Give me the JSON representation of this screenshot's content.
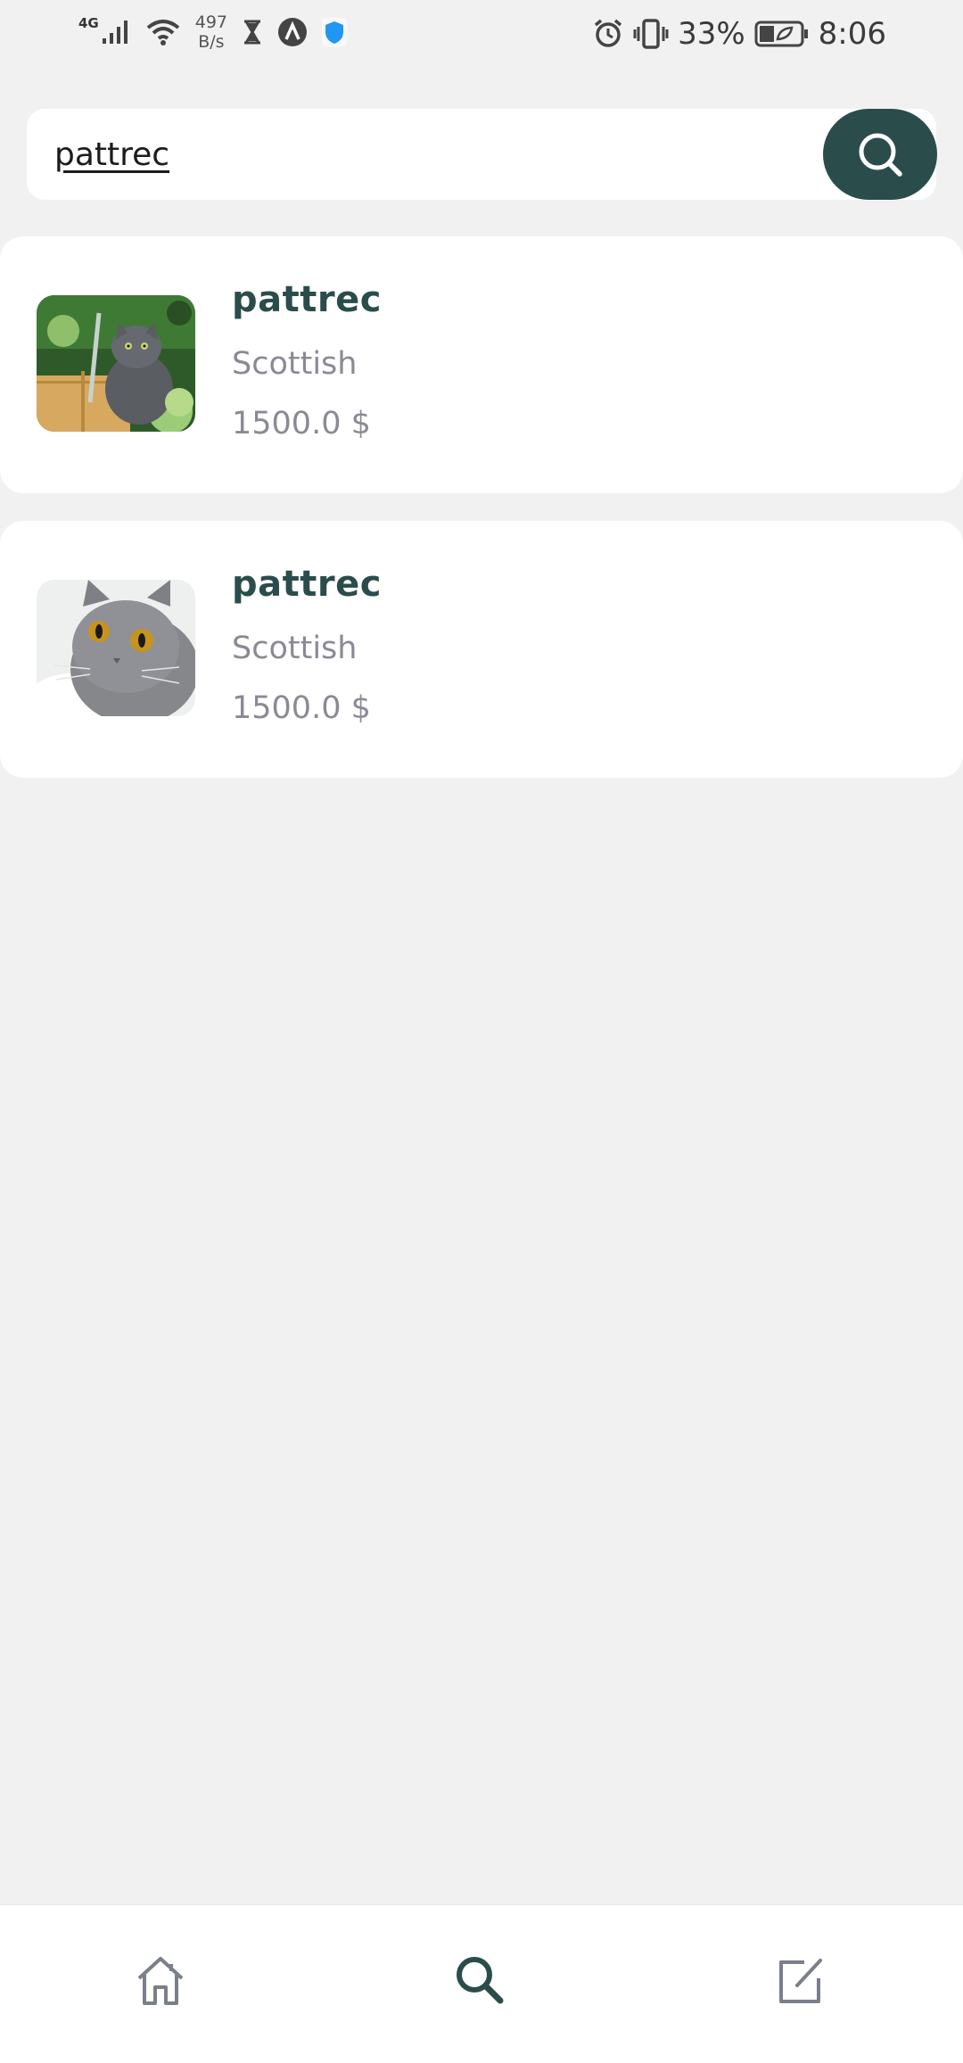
{
  "status_bar": {
    "network_type": "4G",
    "net_speed_value": "497",
    "net_speed_unit": "B/s",
    "battery_percent": "33%",
    "time": "8:06",
    "icons": [
      "signal-icon",
      "wifi-icon",
      "hourglass-icon",
      "a-circle-icon",
      "shield-icon",
      "alarm-icon",
      "vibrate-icon",
      "battery-icon"
    ]
  },
  "search": {
    "value": "pattrec",
    "button_icon": "search-icon"
  },
  "results": [
    {
      "title": "pattrec",
      "breed": "Scottish",
      "price": "1500.0 $",
      "image": "gray-cat-by-fence"
    },
    {
      "title": "pattrec",
      "breed": "Scottish",
      "price": "1500.0 $",
      "image": "gray-cat-orange-eyes"
    }
  ],
  "bottom_nav": {
    "items": [
      {
        "icon": "home-icon",
        "active": false
      },
      {
        "icon": "search-icon",
        "active": true
      },
      {
        "icon": "edit-icon",
        "active": false
      }
    ]
  },
  "colors": {
    "accent": "#2a4d4c",
    "background": "#f1f1f1",
    "card": "#ffffff",
    "muted_text": "#8a8a96"
  }
}
